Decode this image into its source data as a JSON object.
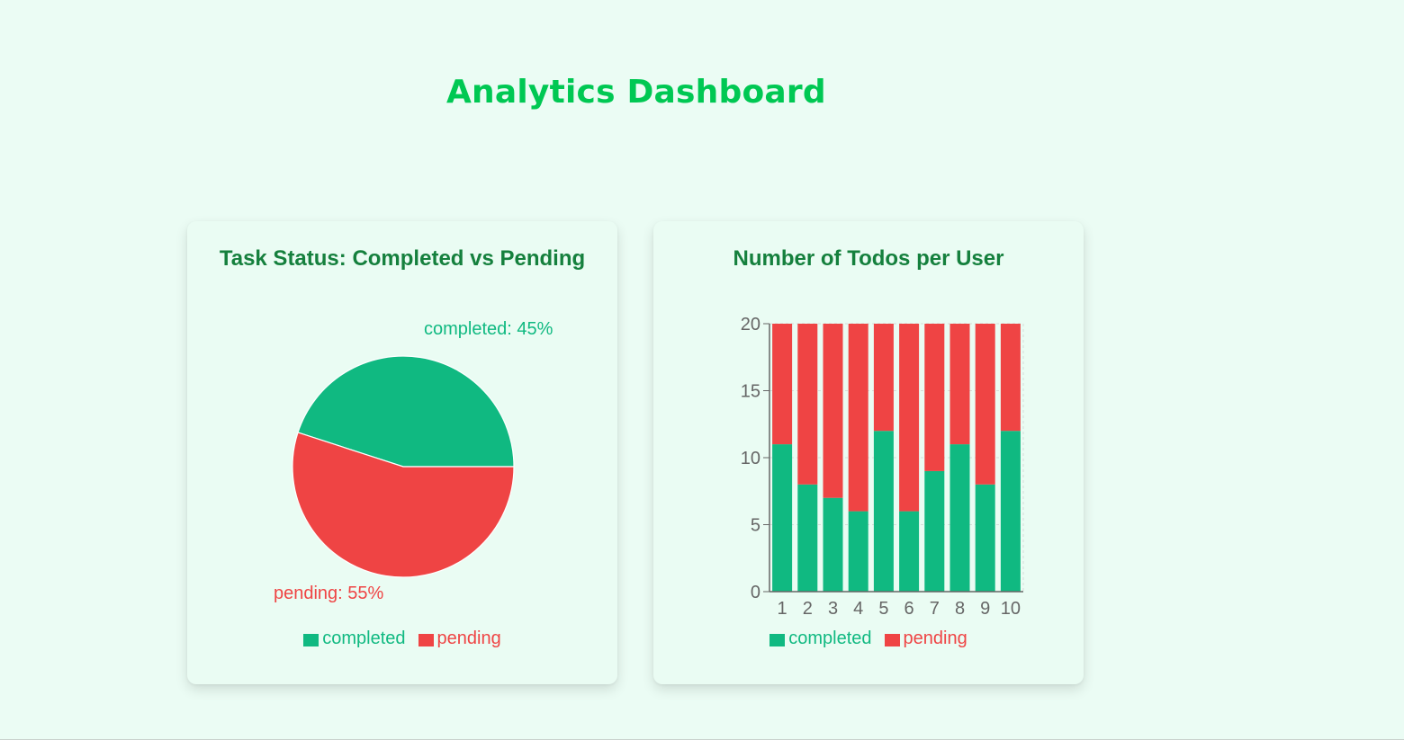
{
  "page": {
    "title": "Analytics Dashboard"
  },
  "colors": {
    "completed": "#10b981",
    "pending": "#ef4444",
    "title": "#00c853",
    "card_title": "#15803d",
    "background": "#ebfcf4"
  },
  "pie_card": {
    "title": "Task Status: Completed vs Pending",
    "slice_labels": {
      "completed": "completed: 45%",
      "pending": "pending: 55%"
    },
    "legend": [
      "completed",
      "pending"
    ]
  },
  "bar_card": {
    "title": "Number of Todos per User",
    "legend": [
      "completed",
      "pending"
    ]
  },
  "chart_data": [
    {
      "type": "pie",
      "title": "Task Status: Completed vs Pending",
      "slices": [
        {
          "name": "completed",
          "value": 45
        },
        {
          "name": "pending",
          "value": 55
        }
      ],
      "legend_position": "bottom"
    },
    {
      "type": "bar",
      "stacked": true,
      "title": "Number of Todos per User",
      "categories": [
        "1",
        "2",
        "3",
        "4",
        "5",
        "6",
        "7",
        "8",
        "9",
        "10"
      ],
      "series": [
        {
          "name": "completed",
          "values": [
            11,
            8,
            7,
            6,
            12,
            6,
            9,
            11,
            8,
            12
          ]
        },
        {
          "name": "pending",
          "values": [
            9,
            12,
            13,
            14,
            8,
            14,
            11,
            9,
            12,
            8
          ]
        }
      ],
      "ylim": [
        0,
        20
      ],
      "yticks": [
        0,
        5,
        10,
        15,
        20
      ],
      "grid": true,
      "legend_position": "bottom"
    }
  ]
}
